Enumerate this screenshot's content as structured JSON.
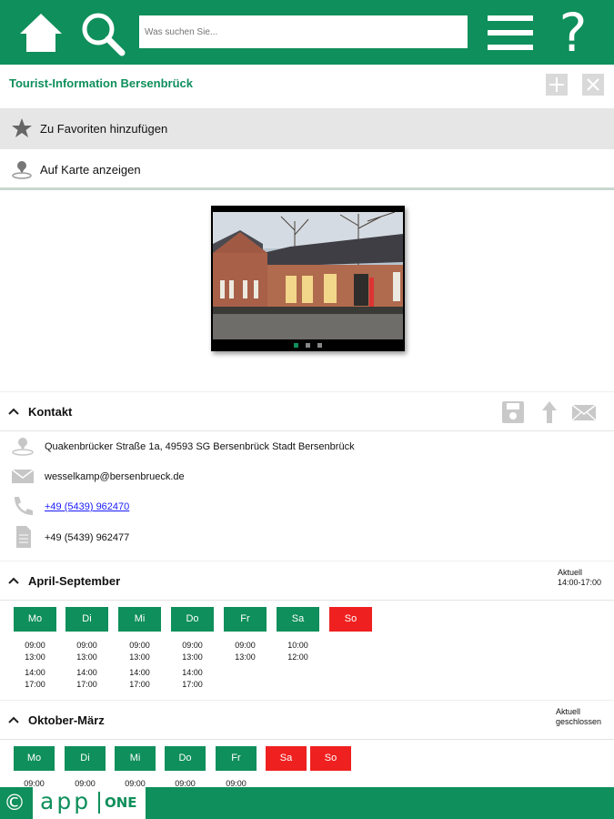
{
  "header": {
    "search_placeholder": "Was suchen Sie...",
    "help_glyph": "?",
    "accent_color": "#0f8f5b",
    "icons": [
      "home-icon",
      "search-icon",
      "menu-icon",
      "help-icon"
    ]
  },
  "place": {
    "title": "Tourist-Information Bersenbrück",
    "favorite_label": "Zu Favoriten hinzufügen",
    "map_label": "Auf Karte anzeigen"
  },
  "gallery": {
    "image_count": 3,
    "active_index": 1
  },
  "contact": {
    "title": "Kontakt",
    "address": "Quakenbrücker Straße 1a, 49593 SG Bersenbrück Stadt Bersenbrück",
    "email": "wesselkamp@bersenbrueck.de",
    "phone": "+49 (5439) 962470",
    "fax": "+49 (5439) 962477"
  },
  "hours": [
    {
      "title": "April-September",
      "status_line1": "Aktuell",
      "status_line2": "14:00-17:00",
      "days": [
        {
          "label": "Mo",
          "open": true,
          "line1": "09:00",
          "line2": "13:00",
          "line3": "14:00",
          "line4": "17:00"
        },
        {
          "label": "Di",
          "open": true,
          "line1": "09:00",
          "line2": "13:00",
          "line3": "14:00",
          "line4": "17:00"
        },
        {
          "label": "Mi",
          "open": true,
          "line1": "09:00",
          "line2": "13:00",
          "line3": "14:00",
          "line4": "17:00"
        },
        {
          "label": "Do",
          "open": true,
          "line1": "09:00",
          "line2": "13:00",
          "line3": "14:00",
          "line4": "17:00"
        },
        {
          "label": "Fr",
          "open": true,
          "line1": "09:00",
          "line2": "13:00",
          "line3": "",
          "line4": ""
        },
        {
          "label": "Sa",
          "open": true,
          "line1": "10:00",
          "line2": "12:00",
          "line3": "",
          "line4": ""
        },
        {
          "label": "So",
          "open": false,
          "line1": "",
          "line2": "",
          "line3": "",
          "line4": ""
        }
      ]
    },
    {
      "title": "Oktober-März",
      "status_line1": "Aktuell",
      "status_line2": "geschlossen",
      "days": [
        {
          "label": "Mo",
          "open": true,
          "line1": "09:00"
        },
        {
          "label": "Di",
          "open": true,
          "line1": "09:00"
        },
        {
          "label": "Mi",
          "open": true,
          "line1": "09:00"
        },
        {
          "label": "Do",
          "open": true,
          "line1": "09:00"
        },
        {
          "label": "Fr",
          "open": true,
          "line1": "09:00"
        },
        {
          "label": "Sa",
          "open": false,
          "line1": ""
        },
        {
          "label": "So",
          "open": false,
          "line1": ""
        }
      ]
    }
  ],
  "footer": {
    "copyright": "©",
    "brand_part1": "app",
    "brand_part2": "ONE"
  }
}
